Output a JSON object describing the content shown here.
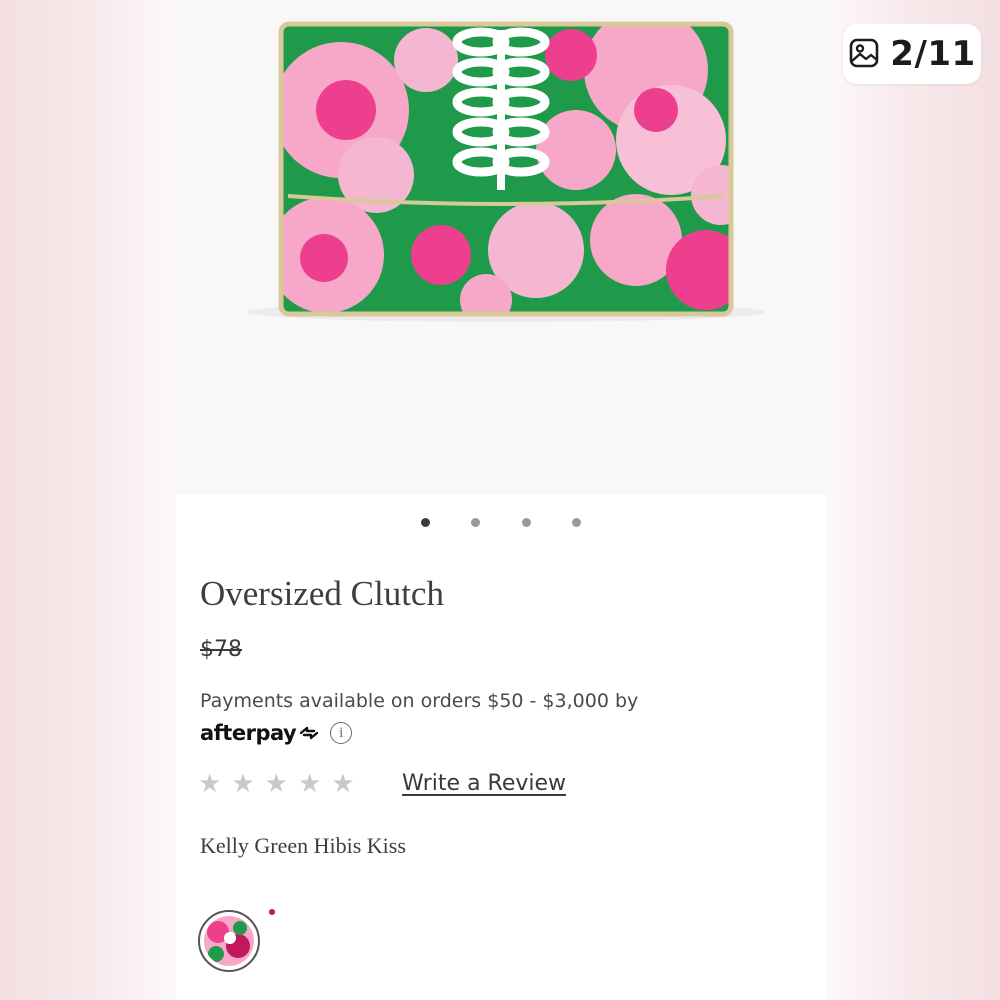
{
  "viewer": {
    "counter": "2/11",
    "counter_icon": "image-gallery-icon"
  },
  "product": {
    "image_alt": "Oversized Clutch product photo",
    "carousel_dots": 4,
    "carousel_active_index": 0,
    "title": "Oversized Clutch",
    "price": "$78",
    "payments_text": "Payments available on orders $50 - $3,000 by",
    "afterpay_label": "afterpay",
    "info_icon": "i",
    "rating_stars": 5,
    "rating_value": 0,
    "review_link": "Write a Review",
    "color_name": "Kelly Green Hibis Kiss"
  },
  "colors": {
    "print_pink": "#f7a8c8",
    "print_hot_pink": "#ee3f8f",
    "print_green": "#1f9a4a",
    "trim_gold": "#d9c89a",
    "swatch_selected_dot": "#c2185b"
  }
}
